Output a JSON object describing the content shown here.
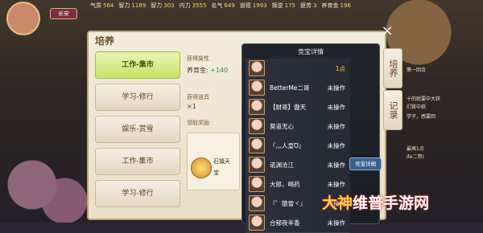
{
  "top_stats": [
    {
      "label": "气质",
      "value": "564"
    },
    {
      "label": "智力",
      "value": "1189"
    },
    {
      "label": "智力",
      "value": "303"
    },
    {
      "label": "内力",
      "value": "3555"
    },
    {
      "label": "名气",
      "value": "649"
    },
    {
      "label": "道德",
      "value": "1993"
    },
    {
      "label": "叛逆",
      "value": "175"
    },
    {
      "label": "疲劳",
      "value": "3"
    },
    {
      "label": "养育金",
      "value": "196"
    }
  ],
  "top_button": "长安",
  "panel": {
    "title": "培养",
    "left_tabs": [
      "工作-集市",
      "学习-修行",
      "娱乐-赏雪",
      "工作-集市",
      "学习-修行"
    ],
    "active_tab_index": 0,
    "middle": {
      "section_label": "获得属性",
      "education_label": "养育金",
      "education_value": "+140",
      "items_label": "获得道具",
      "items_value": "×1",
      "reward_label": "领取奖励",
      "card_text": "石镇天",
      "card_sub": "宝"
    }
  },
  "dialog": {
    "title": "竞宝详情",
    "rows": [
      {
        "name": "",
        "status": "1点",
        "pts": true
      },
      {
        "name": "BetterMe二哥",
        "status": "未操作"
      },
      {
        "name": "【财哥】傲天",
        "status": "未操作"
      },
      {
        "name": "莫道无心",
        "status": "未操作"
      },
      {
        "name": "『灬人皇Ʊ』",
        "status": "未操作"
      },
      {
        "name": "诺渊沧江",
        "status": "未操作"
      },
      {
        "name": "大郎，喝药",
        "status": "未操作"
      },
      {
        "name": "『゜猿雪ヾ』",
        "status": "未操作"
      },
      {
        "name": "合郁夜半香",
        "status": "未操作"
      }
    ]
  },
  "side_tabs": [
    "培养",
    "记录"
  ],
  "right_info": [
    "第一回合",
    "十的就要中大获",
    "们首中获",
    "学子，感要回",
    "最高1点",
    "ife二哥)"
  ],
  "detail_button": "竞宝详细",
  "watermark": {
    "a": "大神",
    "b": "维普手游网"
  }
}
